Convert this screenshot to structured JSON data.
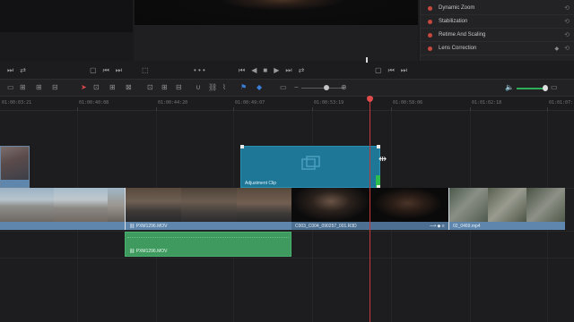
{
  "viewer": {
    "left_controls": [
      "⏭",
      "⇄",
      "▢",
      "⏮",
      "⏭"
    ],
    "center_controls": [
      "⏮",
      "◀",
      "■",
      "▶",
      "⏭",
      "⇄"
    ],
    "right_controls": [
      "▢",
      "⏮",
      "⏭"
    ],
    "crop_icon_glyph": "⬚",
    "dots": "• • •"
  },
  "inspector": {
    "items": [
      {
        "label": "Dynamic Zoom",
        "reset": "⟲"
      },
      {
        "label": "Stabilization",
        "reset": "⟲"
      },
      {
        "label": "Retime And Scaling",
        "reset": "⟲"
      },
      {
        "label": "Lens Correction",
        "reset": "⟲",
        "extra": "◆"
      }
    ]
  },
  "toolbar": {
    "left_tools": [
      "▭",
      "⊞",
      "⊞",
      "⊟",
      "⊠"
    ],
    "pointer_glyph": "➤",
    "edit_tools": [
      "⊡",
      "⊞",
      "⊟"
    ],
    "snap_glyph": "∪",
    "link_glyph": "⛓",
    "blade_glyph": "⌇",
    "flag_glyph": "⚑",
    "marker_glyph": "◆",
    "zoom_minus": "−",
    "zoom_plus": "⊕",
    "volume_glyph": "🔈",
    "meter_glyph": "▭"
  },
  "ruler": {
    "timecodes": [
      "01:00:03:21",
      "01:00:40:08",
      "01:00:44:20",
      "01:00:49:07",
      "01:00:53:19",
      "01:00:58:06",
      "01:01:02:18",
      "01:01:07:"
    ]
  },
  "clips": {
    "adjustment_label": "Adjustment Clip",
    "video_clip_1": "PXM1296.MOV",
    "video_clip_2": "C003_C004_090257_001.R3D",
    "video_clip_3": "02_0469.mp4",
    "audio_clip": "PXM1296.MOV",
    "link_glyph": "⛓",
    "icon_glyphs": "⟶ ◆ ≡"
  },
  "colors": {
    "adjustment_clip": "#1e7797",
    "video_track": "#5f87ad",
    "audio_track": "#3e9a5f",
    "playhead": "#c33a3a",
    "accent_green": "#2dbd4c"
  }
}
